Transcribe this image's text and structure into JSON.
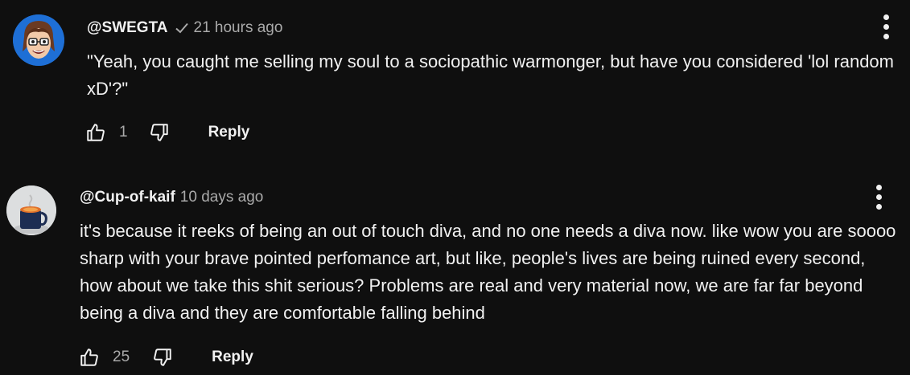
{
  "comments": [
    {
      "author": "@SWEGTA",
      "verified": true,
      "verified_icon": "checkmark-icon",
      "time": "21 hours ago",
      "text": "\"Yeah, you caught me selling my soul to a sociopathic warmonger, but have you considered 'lol random xD'?\"",
      "likes": "1",
      "reply_label": "Reply",
      "avatar_icon": "cartoon-face-avatar"
    },
    {
      "author": "@Cup-of-kaif",
      "verified": false,
      "time": "10 days ago",
      "text": "it's because it reeks of being an out of touch diva, and no one needs a diva now. like wow you are soooo sharp with your brave pointed perfomance art, but like, people's lives are being ruined every second, how about we take this shit serious? Problems are real and very material now, we are far far beyond being a diva and they are comfortable falling behind",
      "likes": "25",
      "reply_label": "Reply",
      "avatar_icon": "coffee-mug-avatar"
    }
  ],
  "colors": {
    "background": "#0f0f0f",
    "text_primary": "#f1f1f1",
    "text_secondary": "#aaaaaa"
  }
}
